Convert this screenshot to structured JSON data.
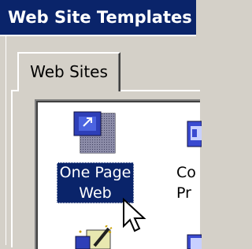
{
  "window": {
    "title": "Web Site Templates"
  },
  "tabs": [
    {
      "label": "Web Sites",
      "active": true
    }
  ],
  "templates": [
    {
      "label_line1": "One Page",
      "label_line2": "Web",
      "selected": true,
      "icon": "one-page-web-icon"
    },
    {
      "label_line1": "Co",
      "label_line2": "Pr",
      "selected": false,
      "icon": "corporate-presence-icon"
    },
    {
      "icon": "wizard-template-icon"
    },
    {
      "icon": "web-template-icon"
    }
  ],
  "colors": {
    "titlebar": "#0a246a",
    "dialog": "#d4d0c8",
    "selection": "#0a246a"
  }
}
